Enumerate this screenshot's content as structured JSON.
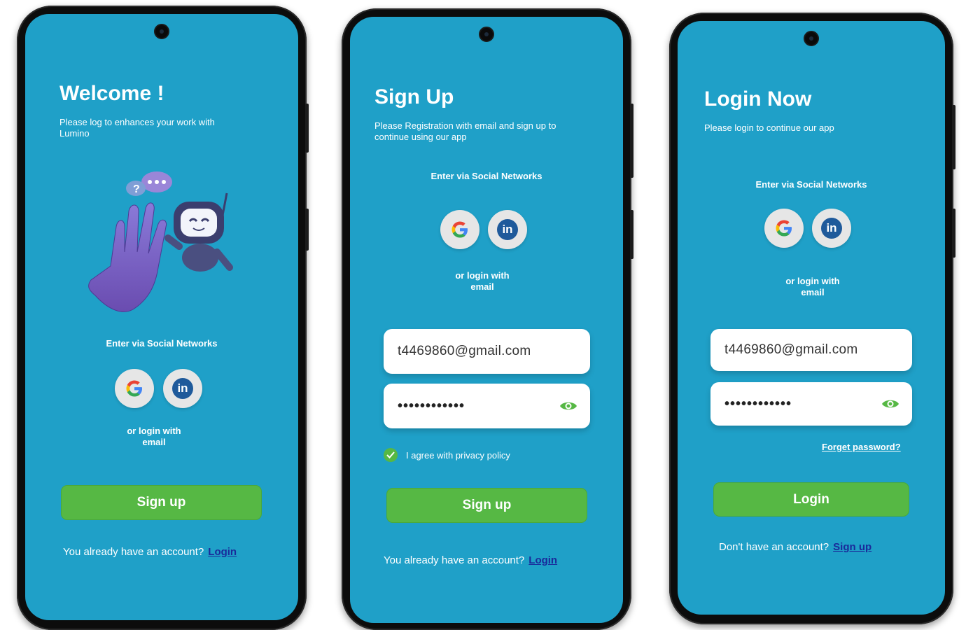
{
  "screens": {
    "welcome": {
      "title": "Welcome !",
      "subtitle": "Please log to enhances your work with Lumino",
      "social_label": "Enter via Social Networks",
      "linkedin_text": "in",
      "or_login": "or login with email",
      "primary_button": "Sign up",
      "footer_text": "You already have an account?",
      "footer_link": "Login"
    },
    "signup": {
      "title": "Sign Up",
      "subtitle": "Please Registration with email and sign up to continue using our app",
      "social_label": "Enter via Social Networks",
      "linkedin_text": "in",
      "or_login": "or login with email",
      "email_value": "t4469860@gmail.com",
      "password_value": "••••••••••••",
      "agree_text": "I agree with privacy policy",
      "agree_checked": true,
      "primary_button": "Sign up",
      "footer_text": "You already have an account?",
      "footer_link": "Login"
    },
    "login": {
      "title": "Login Now",
      "subtitle": "Please login to continue our app",
      "social_label": "Enter via Social Networks",
      "linkedin_text": "in",
      "or_login": "or login with email",
      "email_value": "t4469860@gmail.com",
      "password_value": "••••••••••••",
      "forget_password": "Forget password?",
      "primary_button": "Login",
      "footer_text": "Don't have an account?",
      "footer_link": "Sign up"
    }
  },
  "colors": {
    "screen_bg": "#1fa0c8",
    "button_green": "#56b844",
    "link_blue": "#1a2a9a",
    "linkedin_blue": "#1f5a9b"
  },
  "icons": [
    "google-icon",
    "linkedin-icon",
    "eye-icon",
    "check-icon",
    "camera-icon"
  ]
}
